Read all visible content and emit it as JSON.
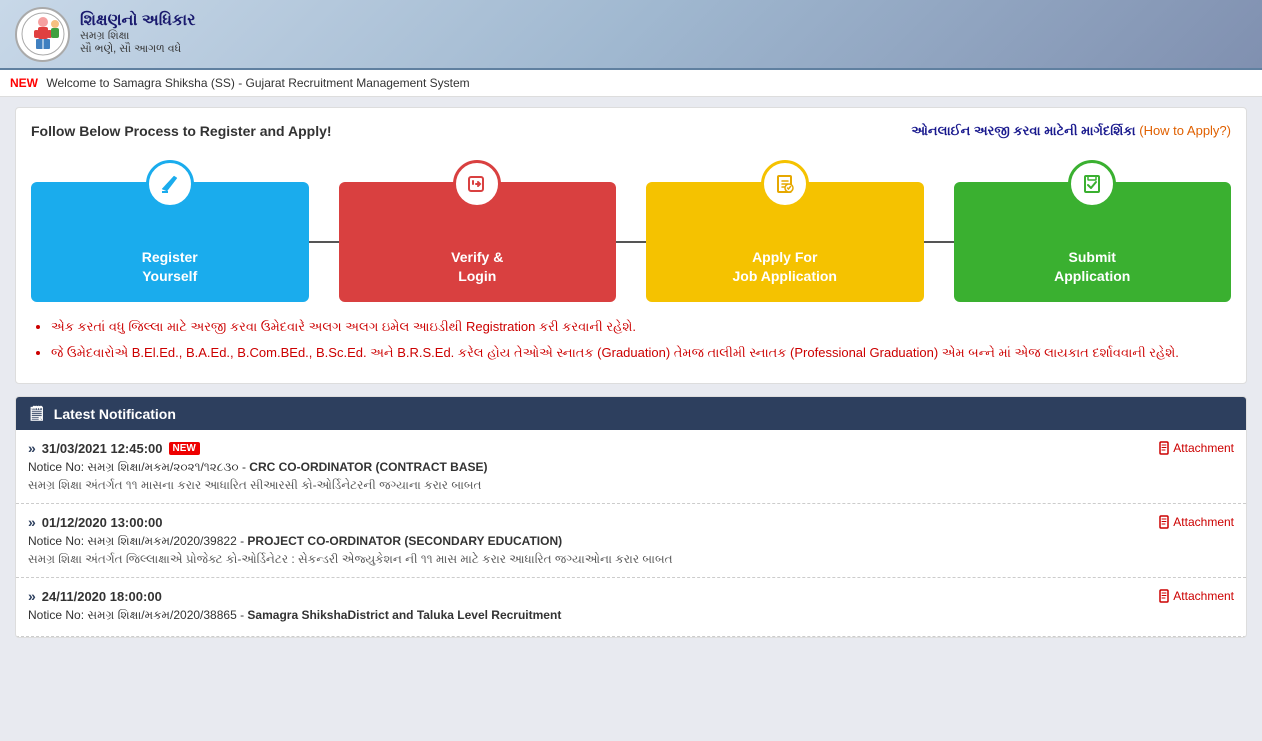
{
  "header": {
    "logo_alt": "Shikshan no Adhikar",
    "title_gujarati": "શિક્ષણનો અધિકાર",
    "subtitle1": "સમગ્ર શિક્ષા",
    "subtitle2": "સૌ ભણે, સૌ આગળ વધે"
  },
  "marquee": {
    "new_badge": "NEW",
    "text": "Welcome to Samagra Shiksha (SS) - Gujarat Recruitment Management System"
  },
  "process": {
    "follow_text": "Follow Below Process to Register and Apply!",
    "how_to_gujarati": "ઓનલાઈન અરજી કરવા માટેની માર્ગદર્શિકા",
    "how_to_link": "(How to Apply?)",
    "steps": [
      {
        "id": "register",
        "label": "Register\nYourself",
        "color": "blue",
        "icon": "✏"
      },
      {
        "id": "verify",
        "label": "Verify &\nLogin",
        "color": "red",
        "icon": "➜"
      },
      {
        "id": "apply",
        "label": "Apply For\nJob Application",
        "color": "yellow",
        "icon": "✎"
      },
      {
        "id": "submit",
        "label": "Submit\nApplication",
        "color": "green",
        "icon": "💾"
      }
    ],
    "bullets": [
      "એક કરતાં વધુ જિલ્લા માટે અરજી કરવા ઉમેદવારે અલગ અલગ ઇમેલ આઇડીથી Registration કરી કરવાની રહેશે.",
      "જે ઉમેદવારોએ B.El.Ed., B.A.Ed., B.Com.BEd., B.Sc.Ed. અને B.R.S.Ed. કરેલ હોય તેઓએ સ્નાતક (Graduation) તેમજ તાલીમી સ્નાતક (Professional Graduation) એમ બન્ને માં એજ લાયકાત દર્શાવવાની રહેશે."
    ]
  },
  "latest_notification": {
    "header": "Latest Notification",
    "header_icon": "🗒",
    "items": [
      {
        "date": "31/03/2021 12:45:00",
        "is_new": true,
        "notice_no": "Notice No: સમગ્ર શિક્ષા/મકમ/૨૦૨૧/૧૨૮૩૦",
        "title": "CRC CO-ORDINATOR (CONTRACT BASE)",
        "description": "સમગ્ર શિક્ષા અંતર્ગત ૧૧ માસના કરાર આધારિત સીઆરસી કો-ઓર્ડિનેટરની જગ્યાના કરાર બાબત",
        "has_attachment": true,
        "attachment_label": "Attachment"
      },
      {
        "date": "01/12/2020 13:00:00",
        "is_new": false,
        "notice_no": "Notice No: સમગ્ર શિક્ષા/મકમ/2020/39822",
        "title": "PROJECT CO-ORDINATOR (SECONDARY EDUCATION)",
        "description": "સમગ્ર શિક્ષા અંતર્ગત જિલ્લાક્ષાએ પ્રોજેક્ટ કો-ઓર્ડિનેટર : સેકન્ડરી એજ્યુકેશન ની ૧૧ માસ માટે કરાર આધારિત જગ્યાઓના કરાર બાબત",
        "has_attachment": true,
        "attachment_label": "Attachment"
      },
      {
        "date": "24/11/2020 18:00:00",
        "is_new": false,
        "notice_no": "Notice No: સમગ્ર શિક્ષા/મકમ/2020/38865",
        "title": "Samagra ShikshaDistrict and Taluka Level Recruitment",
        "description": "",
        "has_attachment": true,
        "attachment_label": "Attachment"
      }
    ]
  }
}
